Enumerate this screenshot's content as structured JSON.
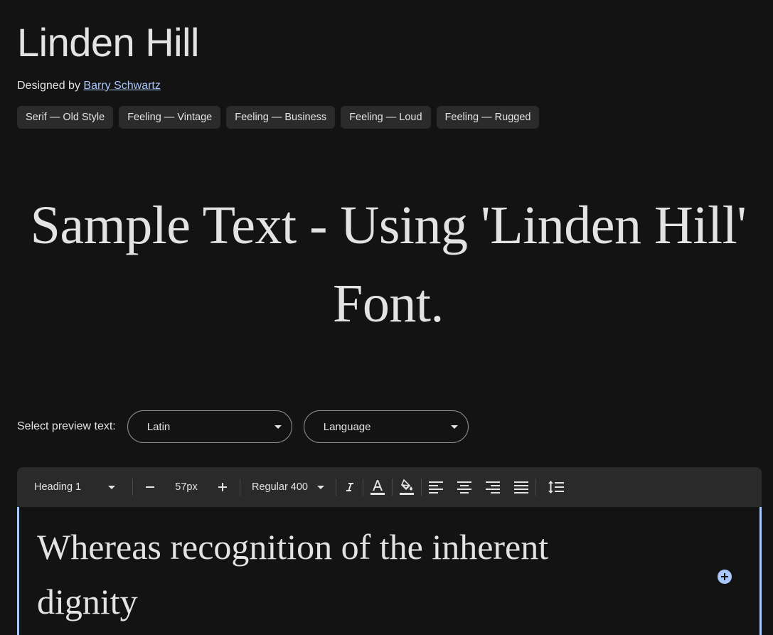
{
  "font": {
    "name": "Linden Hill",
    "designer_prefix": "Designed by ",
    "designer_name": "Barry Schwartz"
  },
  "tags": [
    "Serif — Old Style",
    "Feeling — Vintage",
    "Feeling — Business",
    "Feeling — Loud",
    "Feeling — Rugged"
  ],
  "sample_text": "Sample Text - Using 'Linden Hill' Font.",
  "preview": {
    "label": "Select preview text:",
    "script_value": "Latin",
    "language_value": "Language"
  },
  "toolbar": {
    "style": "Heading 1",
    "size": "57px",
    "weight": "Regular 400",
    "decrease_icon": "minus-icon",
    "increase_icon": "plus-icon"
  },
  "editor": {
    "text": "Whereas recognition of the inherent dignity"
  },
  "colors": {
    "background": "#131313",
    "tag_bg": "#2b2b2b",
    "toolbar_bg": "#2a2a2a",
    "accent": "#a8c7fa",
    "text": "#e3e3e3"
  }
}
